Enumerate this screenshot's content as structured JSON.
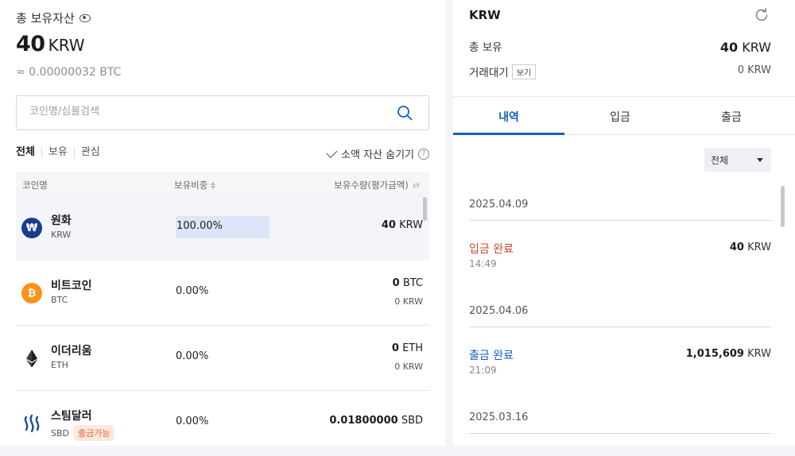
{
  "summary": {
    "total_label": "총 보유자산",
    "total_value": "40",
    "total_unit": "KRW",
    "approx_btc": "≈ 0.00000032 BTC"
  },
  "search": {
    "placeholder": "코인명/심볼검색"
  },
  "filter_tabs": [
    "전체",
    "보유",
    "관심"
  ],
  "hide_small_label": "소액 자산 숨기기",
  "table_headers": {
    "coin": "코인명",
    "ratio": "보유비중",
    "holdings": "보유수량(평가금액)"
  },
  "rows": [
    {
      "name": "원화",
      "symbol": "KRW",
      "ratio": "100.00%",
      "amount": "40",
      "amount_unit": "KRW",
      "icon": "krw-icon",
      "icon_color": "#1a3c8f",
      "icon_glyph": "₩"
    },
    {
      "name": "비트코인",
      "symbol": "BTC",
      "ratio": "0.00%",
      "amount": "0",
      "amount_unit": "BTC",
      "value": "0 KRW",
      "icon": "bitcoin-icon",
      "icon_color": "#f7931a",
      "icon_glyph": "₿"
    },
    {
      "name": "이더리움",
      "symbol": "ETH",
      "ratio": "0.00%",
      "amount": "0",
      "amount_unit": "ETH",
      "value": "0 KRW",
      "icon": "ethereum-icon"
    },
    {
      "name": "스팀달러",
      "symbol": "SBD",
      "badge": "출금가능",
      "ratio": "0.00%",
      "amount": "0.01800000",
      "amount_unit": "SBD",
      "icon": "steem-icon"
    }
  ],
  "detail": {
    "title": "KRW",
    "total_label": "총 보유",
    "total_value": "40",
    "total_unit": "KRW",
    "pending_label": "거래대기",
    "view_btn": "보기",
    "pending_value": "0 KRW",
    "tabs": [
      "내역",
      "입금",
      "출금"
    ],
    "filter": "전체",
    "history": [
      {
        "date": "2025.04.09",
        "type": "입금 완료",
        "time": "14:49",
        "amount": "40",
        "unit": "KRW"
      },
      {
        "date": "2025.04.06",
        "type": "출금 완료",
        "time": "21:09",
        "amount": "1,015,609",
        "unit": "KRW"
      },
      {
        "date": "2025.03.16"
      }
    ]
  },
  "colors": {
    "accent": "#1261c4",
    "deposit": "#c84a31",
    "badge": "#e2662d"
  }
}
